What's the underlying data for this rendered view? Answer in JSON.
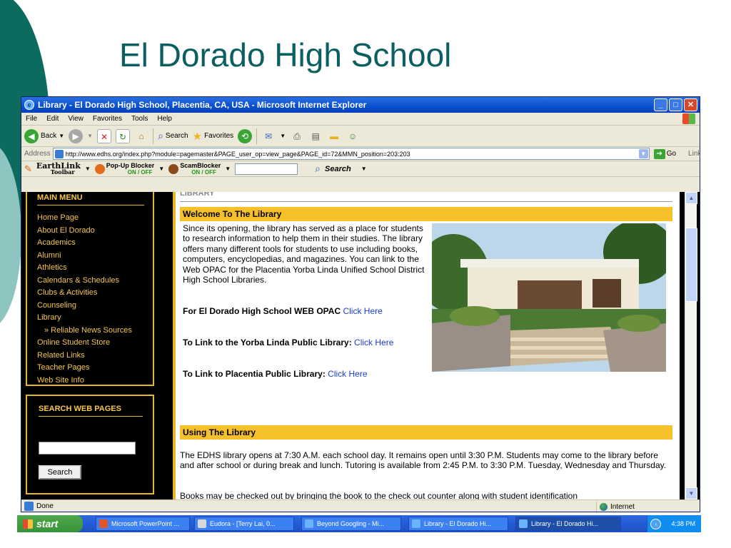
{
  "slide": {
    "title": "El Dorado High School"
  },
  "window": {
    "title": "Library - El Dorado High School, Placentia, CA, USA - Microsoft Internet Explorer",
    "controls": {
      "minimize": "_",
      "maximize": "□",
      "close": "✕"
    }
  },
  "menubar": {
    "items": [
      "File",
      "Edit",
      "View",
      "Favorites",
      "Tools",
      "Help"
    ]
  },
  "toolbar": {
    "back": "Back",
    "search": "Search",
    "favorites": "Favorites"
  },
  "address": {
    "label": "Address",
    "url": "http://www.edhs.org/index.php?module=pagemaster&PAGE_user_op=view_page&PAGE_id=72&MMN_position=203:203",
    "go": "Go",
    "links": "Links"
  },
  "earthlink": {
    "brand": "EarthLink",
    "brand_sub": "Toolbar",
    "popup_blocker": "Pop-Up Blocker",
    "scam_blocker": "ScamBlocker",
    "on_off": "ON / OFF",
    "search": "Search"
  },
  "sidebar": {
    "menu_title": "MAIN MENU",
    "items": [
      {
        "label": "Home Page",
        "sub": false
      },
      {
        "label": "About El Dorado",
        "sub": false
      },
      {
        "label": "Academics",
        "sub": false
      },
      {
        "label": "Alumni",
        "sub": false
      },
      {
        "label": "Athletics",
        "sub": false
      },
      {
        "label": "Calendars & Schedules",
        "sub": false
      },
      {
        "label": "Clubs & Activities",
        "sub": false
      },
      {
        "label": "Counseling",
        "sub": false
      },
      {
        "label": "Library",
        "sub": false
      },
      {
        "label": "» Reliable News Sources",
        "sub": true
      },
      {
        "label": "Online Student Store",
        "sub": false
      },
      {
        "label": "Related Links",
        "sub": false
      },
      {
        "label": "Teacher Pages",
        "sub": false
      },
      {
        "label": "Web Site Info",
        "sub": false
      }
    ],
    "search_title": "SEARCH WEB PAGES",
    "search_button": "Search"
  },
  "main": {
    "breadcrumb": "LIBRARY",
    "welcome_heading": "Welcome To The Library",
    "intro": "Since its opening, the library has served as a place for students to research information to help them in their studies. The library offers many different tools for students to use including books, computers, encyclopedias, and magazines. You can link to the Web OPAC for the Placentia Yorba Linda Unified School District High School Libraries.",
    "link1_label": "For El Dorado High School WEB OPAC",
    "link1_text": "Click Here",
    "link2_label": "To Link to the Yorba Linda Public Library:",
    "link2_text": "Click Here",
    "link3_label": "To Link to Placentia Public Library:",
    "link3_text": "Click Here",
    "using_heading": "Using The Library",
    "using_para": "The EDHS library opens at 7:30 A.M. each school day. It remains open until 3:30 P.M. Students may come to the library before and after school or during break and lunch. Tutoring is available from 2:45 P.M. to 3:30 P.M. Tuesday, Wednesday and Thursday.",
    "books_para": "Books may be checked out by bringing the book to the check out counter along with student identification"
  },
  "status": {
    "text": "Done",
    "zone": "Internet"
  },
  "taskbar": {
    "start": "start",
    "tasks": [
      {
        "label": "Microsoft PowerPoint ...",
        "active": false
      },
      {
        "label": "Eudora - [Terry Lai, 0...",
        "active": false
      },
      {
        "label": "Beyond Googling - Mi...",
        "active": false
      },
      {
        "label": "Library - El Dorado Hi...",
        "active": false
      },
      {
        "label": "Library - El Dorado Hi...",
        "active": true
      }
    ],
    "clock": "4:38 PM"
  }
}
